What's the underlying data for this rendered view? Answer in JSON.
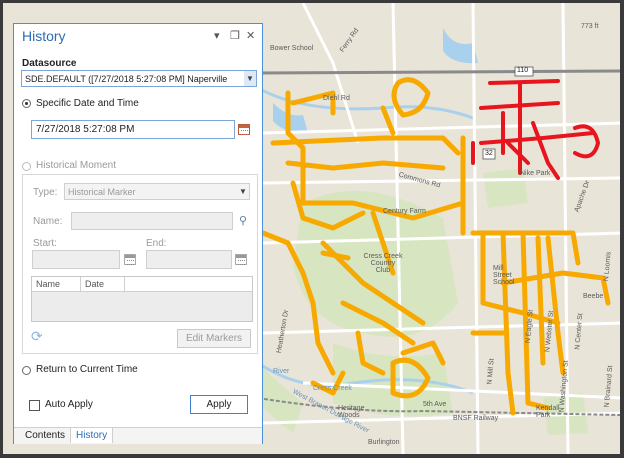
{
  "panel": {
    "title": "History",
    "datasource_label": "Datasource",
    "datasource_value": "SDE.DEFAULT ([7/27/2018 5:27:08 PM] Naperville",
    "specific_label": "Specific Date and Time",
    "specific_datetime": "7/27/2018 5:27:08 PM",
    "historical_label": "Historical Moment",
    "type_label": "Type:",
    "type_value": "Historical Marker",
    "name_label": "Name:",
    "start_label": "Start:",
    "end_label": "End:",
    "grid_columns": [
      "Name",
      "Date"
    ],
    "edit_markers_label": "Edit Markers",
    "return_label": "Return to Current Time",
    "auto_apply_label": "Auto Apply",
    "apply_label": "Apply",
    "tabs": [
      "Contents",
      "History"
    ]
  },
  "window_controls": {
    "menu": "▾",
    "restore": "❐",
    "close": "✕"
  },
  "map": {
    "labels": {
      "ferry_rd": "Ferry Rd",
      "bower_school": "Bower School",
      "diehl_rd": "Diehl Rd",
      "commons_rd": "Commons Rd",
      "century_farm": "Century Farm",
      "cress_creek": "Cress Creek Country Club",
      "mill_street_school": "Mill Street School",
      "nike_park": "Nike Park",
      "apache_dr": "Apache Dr",
      "heatherton_dr": "Heatherton Dr",
      "fifth_ave": "5th Ave",
      "heritage_woods": "Heritage Woods",
      "west_branch": "West Branch DuPage River",
      "bnsf": "BNSF Railway",
      "burlington": "Burlington",
      "kendall_park": "Kendall Park",
      "beebe": "Beebe",
      "n_eagle": "N Eagle St",
      "n_webster": "N Webster St",
      "n_center": "N Center St",
      "n_washington": "N Washington St",
      "n_mill": "N Mill St",
      "n_brainard": "N Brainard St",
      "n_loomis": "N Loomis",
      "route_shield": "110",
      "route_32": "32",
      "n773ft": "773 ft",
      "cress_creek_river": "Cress Creek",
      "river": "River"
    },
    "colors": {
      "land": "#e9e4d8",
      "park": "#d7e5c1",
      "water": "#a9d0ec",
      "road": "#ffffff",
      "highway": "#8a8a8a",
      "orange": "#f7a900",
      "red": "#e8151f"
    }
  }
}
